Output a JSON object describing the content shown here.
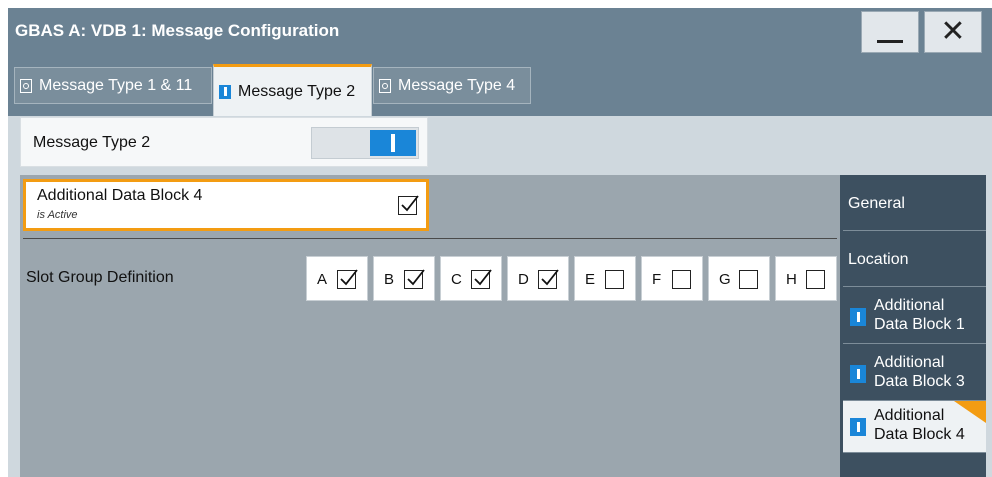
{
  "window": {
    "title": "GBAS A: VDB 1: Message Configuration",
    "minimize_icon": "minimize-icon",
    "close_glyph": "✕"
  },
  "tabs": [
    {
      "label": "Message Type 1 & 11",
      "state": "off"
    },
    {
      "label": "Message Type 2",
      "state": "on",
      "active": true
    },
    {
      "label": "Message Type 4",
      "state": "off"
    }
  ],
  "message_type": {
    "label": "Message Type 2",
    "toggle_on": true
  },
  "additional_data_block": {
    "title": "Additional Data Block 4",
    "subtitle": "is Active",
    "checked": true
  },
  "slot_group": {
    "label": "Slot Group Definition",
    "slots": [
      {
        "letter": "A",
        "checked": true
      },
      {
        "letter": "B",
        "checked": true
      },
      {
        "letter": "C",
        "checked": true
      },
      {
        "letter": "D",
        "checked": true
      },
      {
        "letter": "E",
        "checked": false
      },
      {
        "letter": "F",
        "checked": false
      },
      {
        "letter": "G",
        "checked": false
      },
      {
        "letter": "H",
        "checked": false
      }
    ]
  },
  "side_nav": [
    {
      "label": "General"
    },
    {
      "label": "Location"
    },
    {
      "line1": "Additional",
      "line2": "Data Block 1",
      "indicator": true
    },
    {
      "line1": "Additional",
      "line2": "Data Block 3",
      "indicator": true
    },
    {
      "line1": "Additional",
      "line2": "Data Block 4",
      "indicator": true,
      "active": true
    }
  ],
  "colors": {
    "accent": "#f39c12",
    "indicator_on": "#1a86d8",
    "titlebar": "#6b8293",
    "sidenav": "#3d5060"
  }
}
